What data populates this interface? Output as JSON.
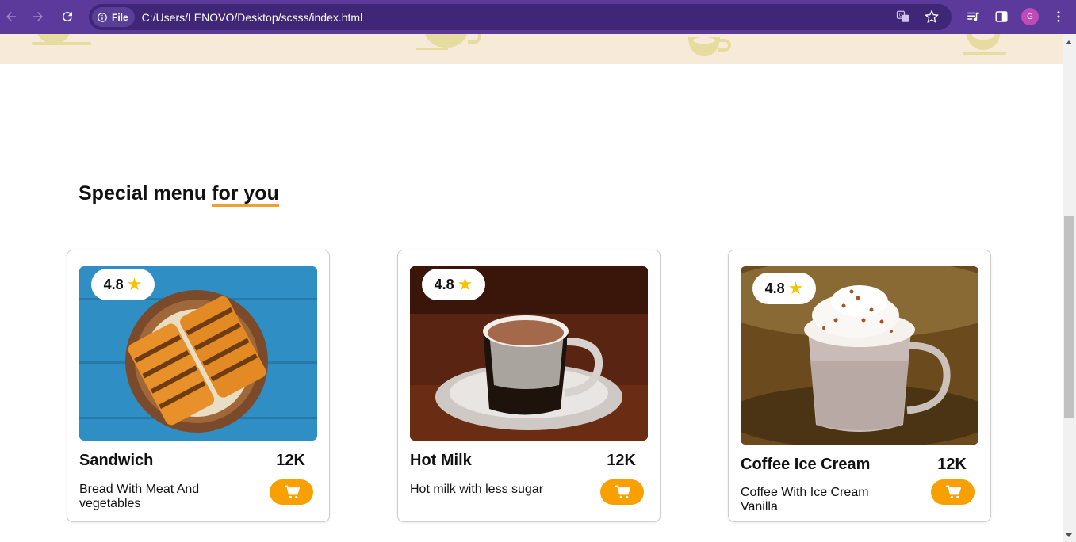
{
  "browser": {
    "site_chip_label": "File",
    "url": "C:/Users/LENOVO/Desktop/scsss/index.html",
    "profile_initial": "G",
    "accent_color": "#5b3a9c"
  },
  "page": {
    "section_title_prefix": "Special menu",
    "section_title_highlight": "for you",
    "highlight_color": "#f0a030",
    "button_color": "#f7a000"
  },
  "menu": {
    "items": [
      {
        "rating": "4.8",
        "name": "Sandwich",
        "price": "12K",
        "description": "Bread With Meat And vegetables"
      },
      {
        "rating": "4.8",
        "name": "Hot Milk",
        "price": "12K",
        "description": "Hot milk with less sugar"
      },
      {
        "rating": "4.8",
        "name": "Coffee Ice Cream",
        "price": "12K",
        "description": "Coffee With Ice Cream Vanilla"
      }
    ]
  }
}
